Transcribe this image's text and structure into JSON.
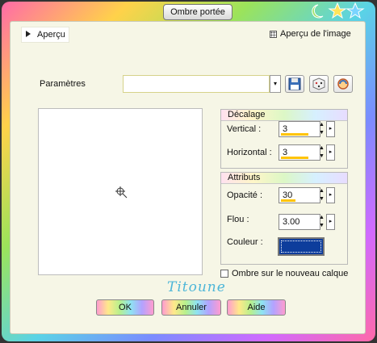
{
  "window": {
    "title": "Ombre portée"
  },
  "preview_section": {
    "label": "Aperçu",
    "image_preview_label": "Aperçu de l'image",
    "image_preview_checked": true
  },
  "settings": {
    "label": "Paramètres",
    "preset_value": ""
  },
  "offset_group": {
    "title": "Décalage",
    "vertical": {
      "label": "Vertical :",
      "value": "3"
    },
    "horizontal": {
      "label": "Horizontal :",
      "value": "3"
    }
  },
  "attributes_group": {
    "title": "Attributs",
    "opacity": {
      "label": "Opacité :",
      "value": "30"
    },
    "blur": {
      "label": "Flou :",
      "value": "3.00"
    },
    "color": {
      "label": "Couleur :",
      "hex": "#0d3d9c"
    }
  },
  "new_layer": {
    "label": "Ombre sur le nouveau calque",
    "checked": false
  },
  "watermark": "Titoune",
  "buttons": {
    "ok": "OK",
    "cancel": "Annuler",
    "help": "Aide"
  }
}
